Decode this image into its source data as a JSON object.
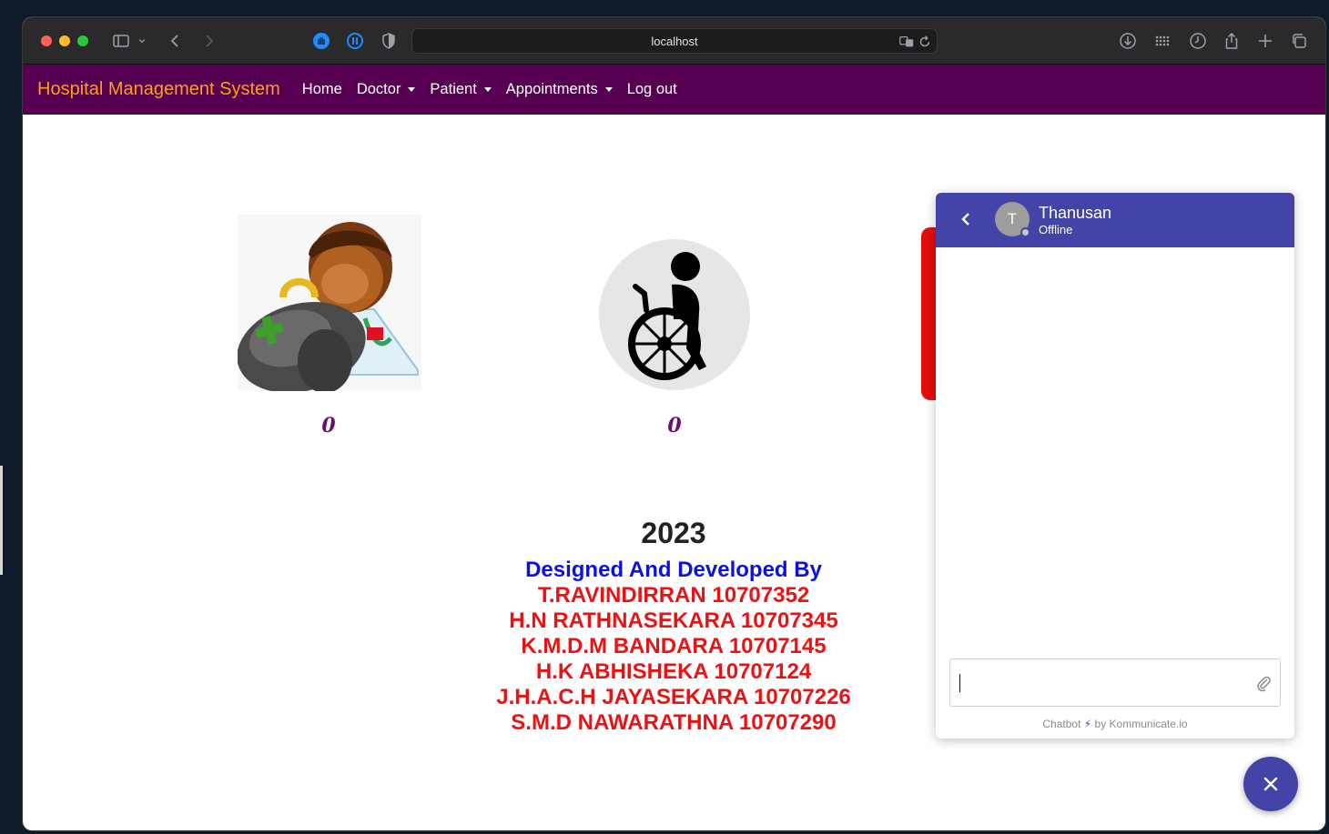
{
  "browser": {
    "url": "localhost"
  },
  "navbar": {
    "brand": "Hospital Management System",
    "items": [
      {
        "label": "Home",
        "dropdown": false
      },
      {
        "label": "Doctor",
        "dropdown": true
      },
      {
        "label": "Patient",
        "dropdown": true
      },
      {
        "label": "Appointments",
        "dropdown": true
      },
      {
        "label": "Log out",
        "dropdown": false
      }
    ]
  },
  "dashboard": {
    "doctor_count": "0",
    "patient_count": "0"
  },
  "footer": {
    "year": "2023",
    "heading": "Designed And Developed By",
    "developers": [
      "T.RAVINDIRRAN 10707352",
      "H.N RATHNASEKARA 10707345",
      "K.M.D.M BANDARA 10707145",
      "H.K ABHISHEKA 10707124",
      "J.H.A.C.H JAYASEKARA 10707226",
      "S.M.D NAWARATHNA 10707290"
    ]
  },
  "chat": {
    "avatar_initial": "T",
    "agent_name": "Thanusan",
    "status": "Offline",
    "powered_prefix": "Chatbot",
    "powered_suffix": "by Kommunicate.io"
  },
  "colors": {
    "navbar_bg": "#570052",
    "brand": "#ff9e1b",
    "chat_header": "#4444a8",
    "credits_heading": "#0a10e8",
    "credits_names": "#ee1111"
  }
}
